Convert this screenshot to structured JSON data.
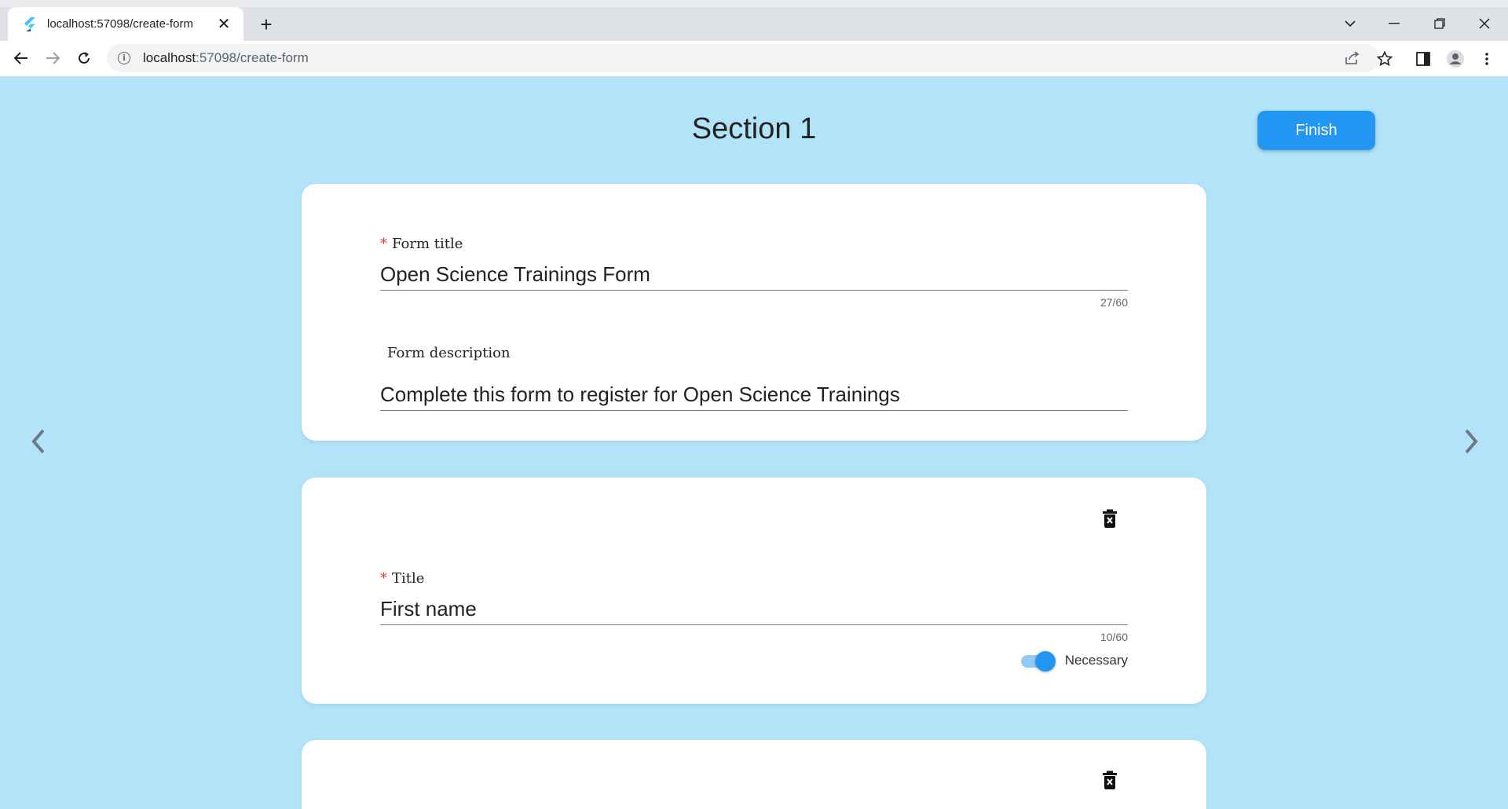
{
  "browser": {
    "tab_title": "localhost:57098/create-form",
    "url_host": "localhost",
    "url_path": ":57098/create-form"
  },
  "page": {
    "section_title": "Section 1",
    "finish_label": "Finish"
  },
  "form_header_card": {
    "title_required_mark": "*",
    "title_label": "Form title",
    "title_value": "Open Science Trainings Form",
    "title_counter": "27/60",
    "description_label": "Form description",
    "description_value": "Complete this form to register for Open Science Trainings"
  },
  "question_card": {
    "title_required_mark": "*",
    "title_label": "Title",
    "title_value": "First name",
    "title_counter": "10/60",
    "necessary_label": "Necessary",
    "necessary_on": true
  },
  "icons": {
    "delete": "delete-forever-icon",
    "prev": "chevron-left-icon",
    "next": "chevron-right-icon"
  },
  "colors": {
    "background": "#b3e3f9",
    "accent": "#2196f3",
    "required": "#e53935"
  }
}
